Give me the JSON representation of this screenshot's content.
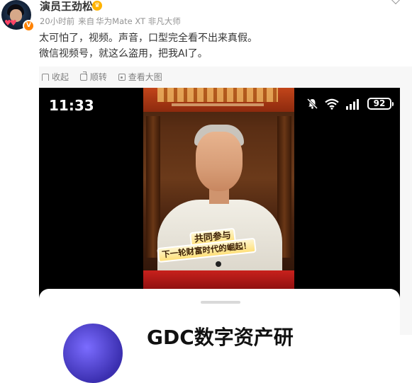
{
  "post": {
    "author": "演员王劲松",
    "time": "20小时前",
    "source_prefix": "来自",
    "source": "华为Mate XT 非凡大师",
    "lines": [
      "太可怕了，视频。声音，口型完全看不出来真假。",
      "微信视频号，就这么盗用，把我AI了。"
    ],
    "actions": [
      {
        "label": "收起",
        "icon": "star-icon"
      },
      {
        "label": "顺转",
        "icon": "repost-icon"
      },
      {
        "label": "查看大图",
        "icon": "image-icon"
      }
    ]
  },
  "phone": {
    "time": "11:33",
    "battery": "92",
    "status_icons": [
      "mute-bell-icon",
      "wifi-icon",
      "signal-icon",
      "battery-icon"
    ]
  },
  "video": {
    "caption_line1": "共同参与",
    "caption_line2": "下一轮财富时代的崛起！"
  },
  "card": {
    "title": "GDC数字资产研"
  },
  "colors": {
    "accent": "#ff8200",
    "text": "#333333",
    "meta": "#939393",
    "repost_bg": "#f7f7f7"
  }
}
